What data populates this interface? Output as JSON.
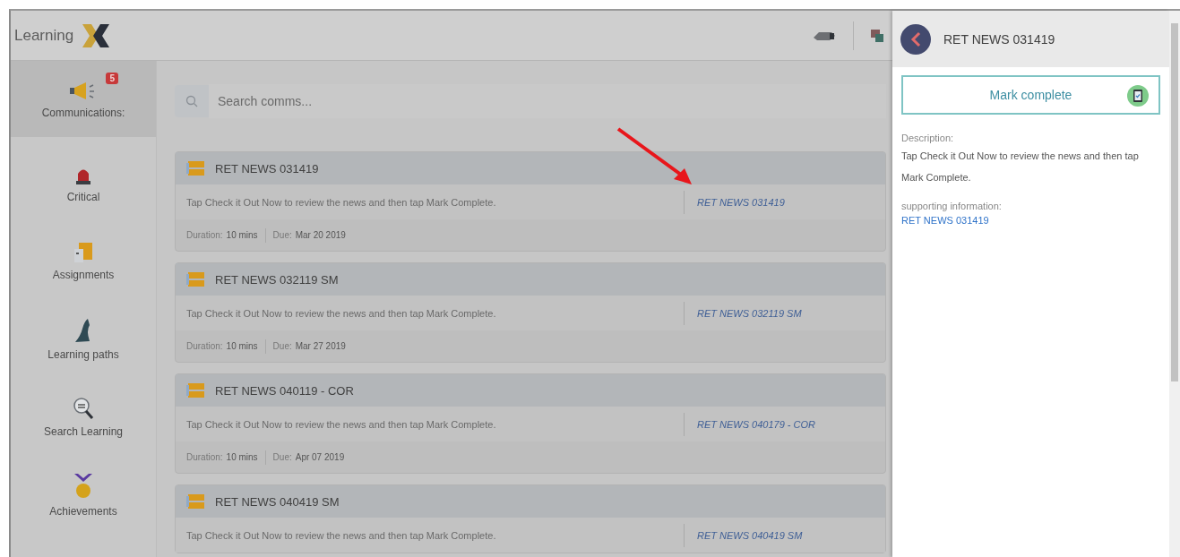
{
  "app": {
    "logo_text": "Learning"
  },
  "sidebar": {
    "items": [
      {
        "label": "Communications:",
        "badge": "5",
        "selected": true
      },
      {
        "label": "Critical",
        "selected": false
      },
      {
        "label": "Assignments",
        "selected": false
      },
      {
        "label": "Learning paths",
        "selected": false
      },
      {
        "label": "Search Learning",
        "selected": false
      },
      {
        "label": "Achievements",
        "selected": false
      }
    ]
  },
  "search": {
    "placeholder": "Search comms..."
  },
  "cards": [
    {
      "title": "RET NEWS 031419",
      "description": "Tap Check it Out Now to review the news and then tap Mark Complete.",
      "link": "RET NEWS 031419",
      "duration_label": "Duration:",
      "duration": "10 mins",
      "due_label": "Due:",
      "due": "Mar 20 2019"
    },
    {
      "title": "RET NEWS 032119 SM",
      "description": "Tap Check it Out Now to review the news and then tap Mark Complete.",
      "link": "RET NEWS 032119 SM",
      "duration_label": "Duration:",
      "duration": "10 mins",
      "due_label": "Due:",
      "due": "Mar 27 2019"
    },
    {
      "title": "RET NEWS 040119 - COR",
      "description": "Tap Check it Out Now to review the news and then tap Mark Complete.",
      "link": "RET NEWS 040179 - COR",
      "duration_label": "Duration:",
      "duration": "10 mins",
      "due_label": "Due:",
      "due": "Apr 07 2019"
    },
    {
      "title": "RET NEWS 040419 SM",
      "description": "Tap Check it Out Now to review the news and then tap Mark Complete.",
      "link": "RET NEWS 040419 SM"
    }
  ],
  "panel": {
    "title": "RET NEWS 031419",
    "mark_complete": "Mark complete",
    "description_label": "Description:",
    "description": "Tap Check it Out Now to review the news and then tap Mark Complete.",
    "supporting_label": "supporting information:",
    "supporting_link": "RET NEWS 031419"
  }
}
